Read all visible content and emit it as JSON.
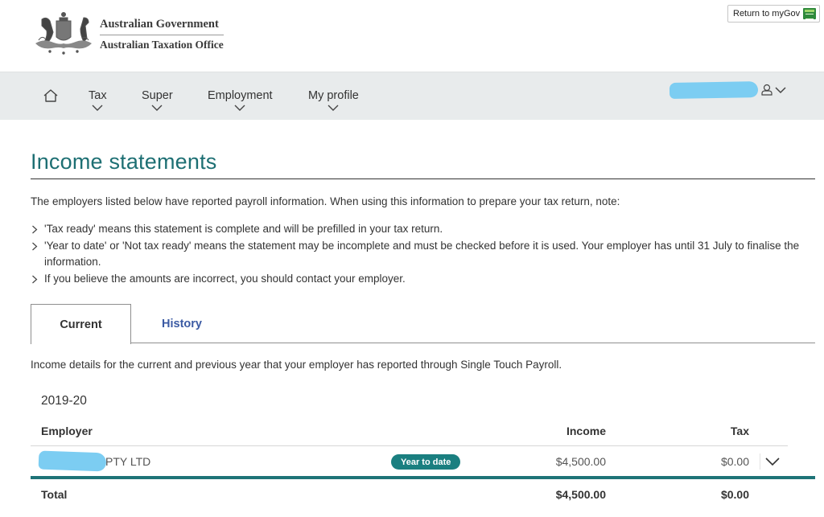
{
  "header": {
    "logo_line1": "Australian Government",
    "logo_line2": "Australian Taxation Office",
    "return_button": "Return to myGov",
    "mygov_icon": "mygov-app-icon"
  },
  "nav": {
    "home_icon": "home-icon",
    "items": [
      {
        "label": "Tax"
      },
      {
        "label": "Super"
      },
      {
        "label": "Employment"
      },
      {
        "label": "My profile"
      }
    ],
    "user_icon": "user-icon"
  },
  "page": {
    "title": "Income statements",
    "intro": "The employers listed below have reported payroll information. When using this information to prepare your tax return, note:",
    "notes": [
      "'Tax ready' means this statement is complete and will be prefilled in your tax return.",
      "'Year to date' or 'Not tax ready' means the statement may be incomplete and must be checked before it is used. Your employer has until 31 July to finalise the information.",
      "If you believe the amounts are incorrect, you should contact your employer."
    ]
  },
  "tabs": [
    {
      "label": "Current",
      "active": true
    },
    {
      "label": "History",
      "active": false
    }
  ],
  "tab_description": "Income details for the current and previous year that your employer has reported through Single Touch Payroll.",
  "statement": {
    "year": "2019-20",
    "columns": {
      "employer": "Employer",
      "income": "Income",
      "tax": "Tax"
    },
    "rows": [
      {
        "employer": "PTY LTD",
        "status": "Year to date",
        "income": "$4,500.00",
        "tax": "$0.00"
      }
    ],
    "total": {
      "label": "Total",
      "income": "$4,500.00",
      "tax": "$0.00"
    }
  },
  "colors": {
    "accent_teal": "#1e7377",
    "title_teal": "#1d6f73",
    "badge": "#1a7f80",
    "link_blue": "#3b5aa3",
    "nav_bg": "#e8ebec",
    "redaction": "#7ccdf2"
  }
}
